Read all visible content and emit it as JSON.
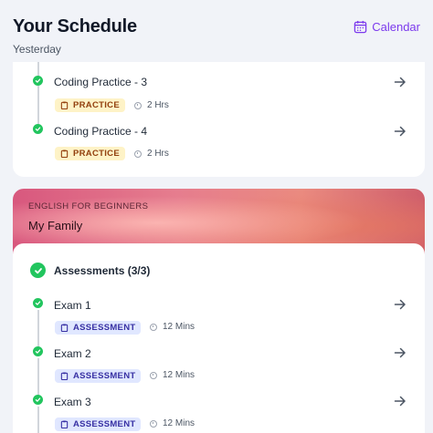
{
  "header": {
    "title": "Your Schedule",
    "calendar_label": "Calendar"
  },
  "section_day": "Yesterday",
  "practice_items": [
    {
      "title": "Coding Practice - 3",
      "badge": "PRACTICE",
      "duration": "2 Hrs"
    },
    {
      "title": "Coding Practice - 4",
      "badge": "PRACTICE",
      "duration": "2 Hrs"
    }
  ],
  "course": {
    "name": "ENGLISH FOR BEGINNERS",
    "lesson": "My Family",
    "group_title": "Assessments (3/3)",
    "items": [
      {
        "title": "Exam 1",
        "badge": "ASSESSMENT",
        "duration": "12 Mins"
      },
      {
        "title": "Exam 2",
        "badge": "ASSESSMENT",
        "duration": "12 Mins"
      },
      {
        "title": "Exam 3",
        "badge": "ASSESSMENT",
        "duration": "12 Mins"
      }
    ]
  },
  "colors": {
    "accent": "#7c3aed",
    "done": "#22c55e",
    "practice_bg": "#fef3c7",
    "assessment_bg": "#e0e7ff"
  },
  "icons": [
    "calendar-icon",
    "check-icon",
    "arrow-right-icon",
    "clipboard-icon",
    "clock-icon"
  ]
}
